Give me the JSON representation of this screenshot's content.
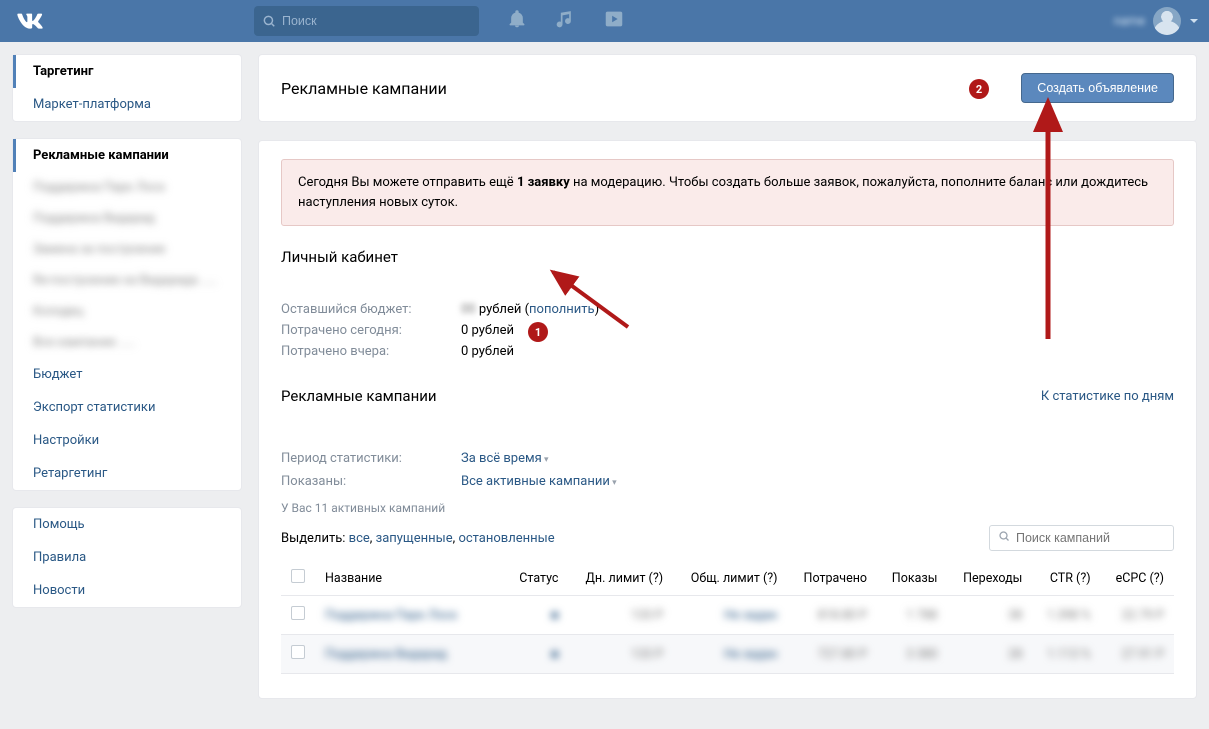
{
  "header": {
    "search_placeholder": "Поиск",
    "user_name": "name"
  },
  "sidebar": {
    "group1": {
      "targeting": "Таргетинг",
      "market": "Маркет-платформа"
    },
    "group2": {
      "header": "Рекламные кампании",
      "blurred_items": [
        "Поддержка Парк Лоск",
        "Поддержка Видарид",
        "Замена за построение",
        "Re-построение на Видарида .....",
        "Колодец",
        "Все кампании ....."
      ],
      "budget": "Бюджет",
      "export": "Экспорт статистики",
      "settings": "Настройки",
      "retargeting": "Ретаргетинг"
    },
    "group3": {
      "help": "Помощь",
      "rules": "Правила",
      "news": "Новости"
    }
  },
  "main": {
    "title": "Рекламные кампании",
    "create_btn": "Создать объявление",
    "notice_pre": "Сегодня Вы можете отправить ещё ",
    "notice_bold": "1 заявку",
    "notice_post": " на модерацию. Чтобы создать больше заявок, пожалуйста, пополните баланс или дождитесь наступления новых суток.",
    "account_title": "Личный кабинет",
    "budget": {
      "remaining_label": "Оставшийся бюджет:",
      "remaining_value_blur": "00",
      "remaining_currency": "рублей",
      "topup": "пополнить",
      "spent_today_label": "Потрачено сегодня:",
      "spent_today_value": "0 рублей",
      "spent_yesterday_label": "Потрачено вчера:",
      "spent_yesterday_value": "0 рублей"
    },
    "campaigns_title": "Рекламные кампании",
    "stats_link": "К статистике по дням",
    "filters": {
      "period_label": "Период статистики:",
      "period_value": "За всё время",
      "shown_label": "Показаны:",
      "shown_value": "Все активные кампании"
    },
    "active_count_line": "У Вас 11 активных кампаний",
    "select_label": "Выделить:",
    "select_all": "все",
    "select_running": "запущенные",
    "select_stopped": "остановленные",
    "search_campaigns_placeholder": "Поиск кампаний",
    "table": {
      "headers": {
        "name": "Название",
        "status": "Статус",
        "day_limit": "Дн. лимит (?)",
        "total_limit": "Общ. лимит (?)",
        "spent": "Потрачено",
        "impressions": "Показы",
        "clicks": "Переходы",
        "ctr": "CTR (?)",
        "ecpc": "eCPC (?)"
      },
      "rows": [
        {
          "name": "Поддержка Парк Лоск",
          "status": "■",
          "day_limit": "133 P",
          "total_limit": "Не задан",
          "spent": "818.80 P",
          "impressions": "1 788",
          "clicks": "38",
          "ctr": "1.398 %",
          "ecpc": "22.79 P"
        },
        {
          "name": "Поддержка Видарид",
          "status": "■",
          "day_limit": "133 P",
          "total_limit": "Не задан",
          "spent": "727.80 P",
          "impressions": "3 380",
          "clicks": "28",
          "ctr": "1.113 %",
          "ecpc": "27.91 P"
        }
      ]
    }
  },
  "annotations": {
    "b1": "1",
    "b2": "2"
  }
}
